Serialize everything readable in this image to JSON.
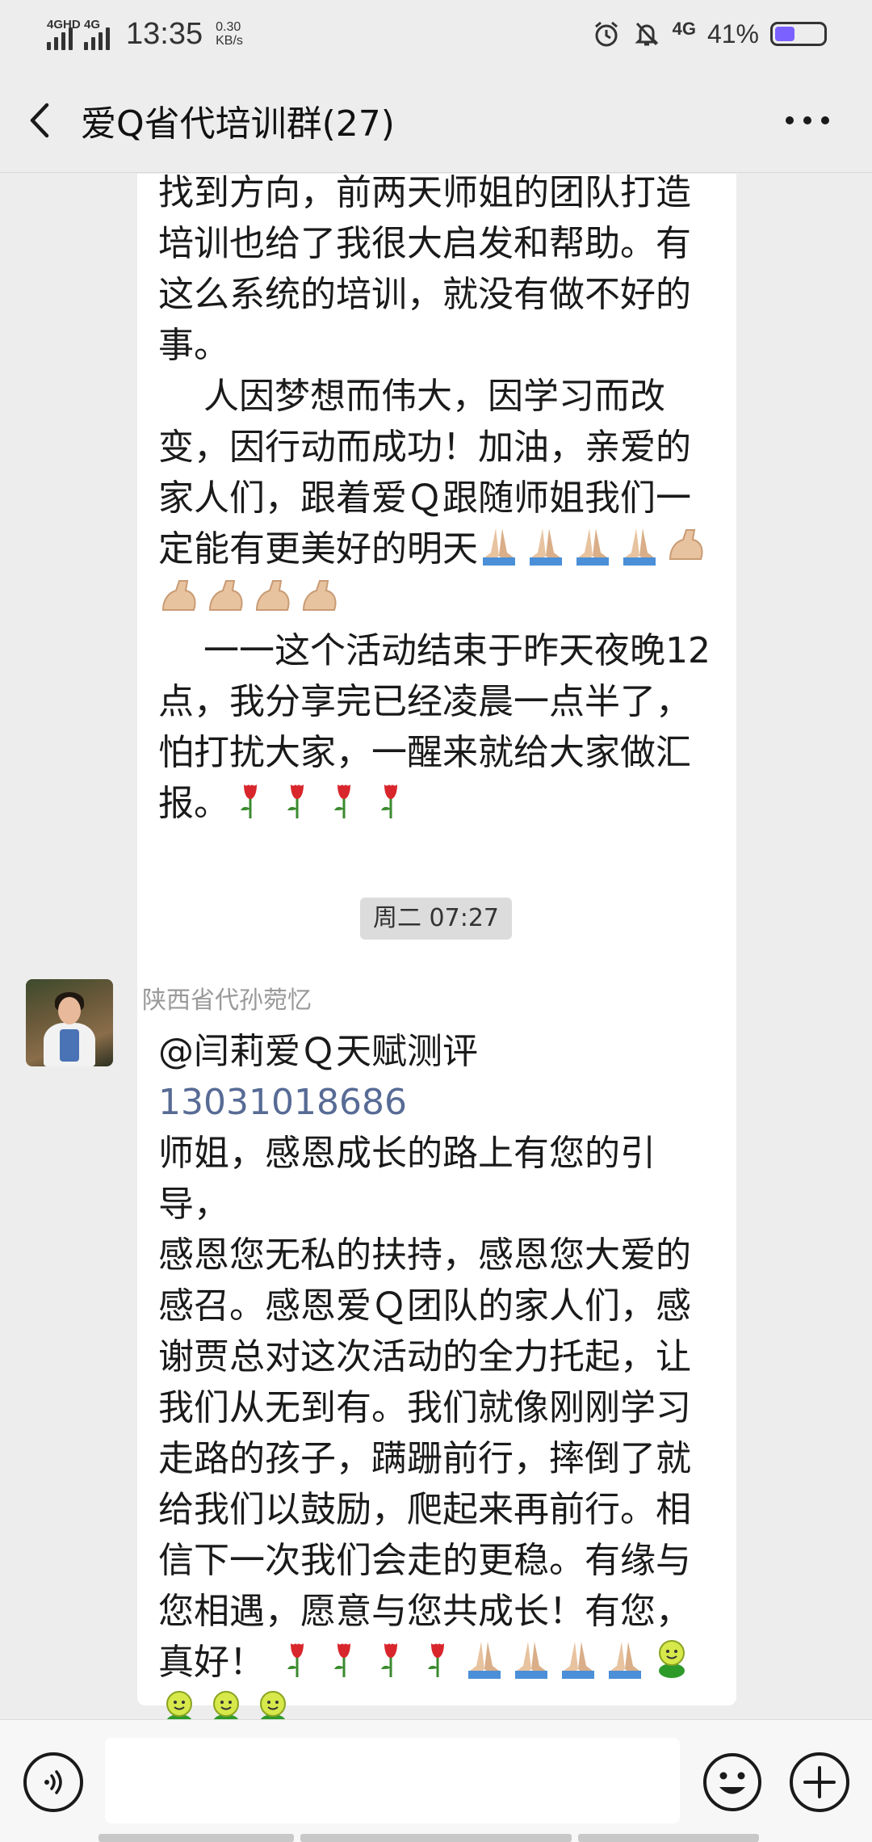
{
  "status_bar": {
    "signal1_label": "4GHD",
    "signal2_label": "4G",
    "time": "13:35",
    "speed_value": "0.30",
    "speed_unit": "KB/s",
    "network_label": "4G",
    "battery_pct": "41%",
    "battery_level": 0.41,
    "icons": [
      "alarm-icon",
      "mute-bell-icon",
      "signal-icon",
      "battery-icon"
    ]
  },
  "header": {
    "title": "爱Q省代培训群(27)",
    "back_icon": "chevron-left-icon",
    "more_icon": "more-dots-icon"
  },
  "messages": [
    {
      "lines": [
        "找到方向，前两天师姐的团队打造",
        "培训也给了我很大启发和帮助。有",
        "这么系统的培训，就没有做不好的",
        "事。",
        "    人因梦想而伟大，因学习而改",
        "变，因行动而成功！加油，亲爱的",
        "家人们，跟着爱Ｑ跟随师姐我们一",
        "定能有更美好的明天",
        "",
        "    一一这个活动结束于昨天夜晚12",
        "点，我分享完已经凌晨一点半了，",
        "怕打扰大家，一醒来就给大家做汇",
        "报。"
      ],
      "emojis_line8": [
        "folded-hands",
        "folded-hands",
        "folded-hands",
        "folded-hands",
        "flexed-biceps"
      ],
      "emojis_line9": [
        "flexed-biceps",
        "flexed-biceps",
        "flexed-biceps",
        "flexed-biceps"
      ],
      "emojis_line13": [
        "rose",
        "rose",
        "rose",
        "rose"
      ]
    }
  ],
  "timestamp": "周二 07:27",
  "message2": {
    "sender": "陕西省代孙菀忆",
    "mention": "@闫莉爱Ｑ天赋测评",
    "phone": "13031018686",
    "lines": [
      "师姐，感恩成长的路上有您的引导，",
      "感恩您无私的扶持，感恩您大爱的",
      "感召。感恩爱Ｑ团队的家人们，感",
      "谢贾总对这次活动的全力托起，让",
      "我们从无到有。我们就像刚刚学习",
      "走路的孩子，蹒跚前行，摔倒了就",
      "给我们以鼓励，爬起来再前行。相",
      "信下一次我们会走的更稳。有缘与",
      "您相遇，愿意与您共成长！有您，",
      "真好！"
    ],
    "emojis_last": [
      "rose",
      "rose",
      "rose",
      "rose",
      "folded-hands",
      "folded-hands",
      "folded-hands",
      "folded-hands",
      "green-smiley"
    ],
    "emojis_tail": [
      "green-smiley",
      "green-smiley",
      "green-smiley"
    ]
  },
  "bottom_bar": {
    "voice_icon": "voice-icon",
    "emoji_icon": "emoji-face-icon",
    "add_icon": "plus-circle-icon",
    "input_value": ""
  }
}
